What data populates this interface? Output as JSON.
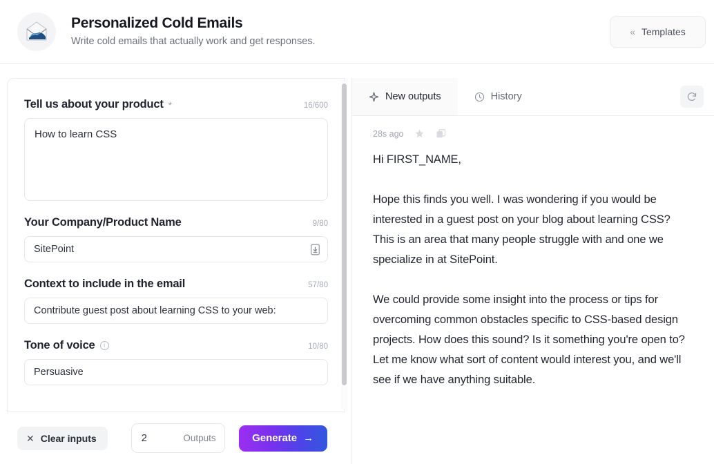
{
  "header": {
    "app_icon": "open-envelope-icon",
    "title": "Personalized Cold Emails",
    "subtitle": "Write cold emails that actually work and get responses.",
    "templates_button": {
      "label": "Templates",
      "icon": "chevron-double-left-icon",
      "chevrons": "«"
    }
  },
  "form": {
    "fields": [
      {
        "label": "Tell us about your product",
        "required_marker": "*",
        "counter": "16/600",
        "value": "How to learn CSS",
        "type": "textarea"
      },
      {
        "label": "Your Company/Product Name",
        "counter": "9/80",
        "value": "SitePoint",
        "type": "input",
        "trailing_icon": "save-to-brand-icon"
      },
      {
        "label": "Context to include in the email",
        "counter": "57/80",
        "value": "Contribute guest post about learning CSS to your web:",
        "type": "input"
      },
      {
        "label": "Tone of voice",
        "info_icon": "info-icon",
        "info_glyph": "i",
        "counter": "10/80",
        "value": "Persuasive",
        "type": "input"
      }
    ]
  },
  "bottom_bar": {
    "clear_inputs": {
      "label": "Clear inputs",
      "icon": "close-x-icon",
      "glyph": "✕"
    },
    "outputs": {
      "value": "2",
      "label": "Outputs"
    },
    "generate": {
      "label": "Generate",
      "icon": "arrow-right-icon",
      "glyph": "→"
    }
  },
  "right_panel": {
    "tabs": [
      {
        "label": "New outputs",
        "icon": "sparkle-icon",
        "active": true
      },
      {
        "label": "History",
        "icon": "clock-icon",
        "active": false
      }
    ],
    "refresh_icon": "refresh-icon",
    "output": {
      "timestamp": "28s ago",
      "star_icon": "star-icon",
      "copy_icon": "copy-icon",
      "paragraphs": [
        "Hi FIRST_NAME,",
        "Hope this finds you well. I was wondering if you would be interested in a guest post on your blog about learning CSS? This is an area that many people struggle with and one we specialize in at SitePoint.",
        "We could provide some insight into the process or tips for overcoming common obstacles specific to CSS-based design projects. How does this sound? Is it something you're open to? Let me know what sort of content would interest you, and we'll see if we have anything suitable."
      ]
    }
  },
  "colors": {
    "generate_gradient_start": "#9B2FF0",
    "generate_gradient_end": "#3457DD",
    "border": "#ECECF0",
    "muted_text": "#A6ABB6"
  }
}
